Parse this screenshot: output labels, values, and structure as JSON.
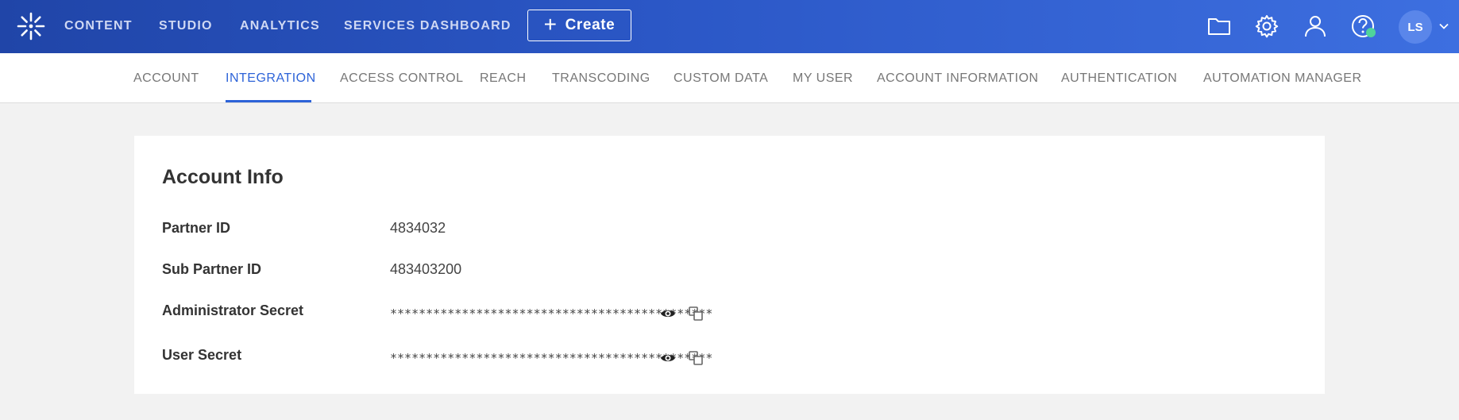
{
  "topnav": {
    "items": [
      {
        "label": "CONTENT"
      },
      {
        "label": "STUDIO"
      },
      {
        "label": "ANALYTICS"
      },
      {
        "label": "SERVICES DASHBOARD"
      }
    ],
    "create_label": "Create",
    "icons": [
      "logo-icon",
      "folder-icon",
      "gear-icon",
      "user-icon",
      "help-icon",
      "chevron-down-icon"
    ],
    "avatar_initials": "LS"
  },
  "subnav": {
    "items": [
      {
        "label": "ACCOUNT"
      },
      {
        "label": "INTEGRATION"
      },
      {
        "label": "ACCESS CONTROL"
      },
      {
        "label": "REACH"
      },
      {
        "label": "TRANSCODING"
      },
      {
        "label": "CUSTOM DATA"
      },
      {
        "label": "MY USER"
      },
      {
        "label": "ACCOUNT INFORMATION"
      },
      {
        "label": "AUTHENTICATION"
      },
      {
        "label": "AUTOMATION MANAGER"
      }
    ],
    "active": "INTEGRATION"
  },
  "account_info": {
    "title": "Account Info",
    "rows": [
      {
        "label": "Partner ID",
        "value": "4834032"
      },
      {
        "label": "Sub Partner ID",
        "value": "483403200"
      },
      {
        "label": "Administrator Secret",
        "value": "*********************************************"
      },
      {
        "label": "User Secret",
        "value": "*********************************************"
      }
    ]
  },
  "colors": {
    "header_start": "#2045a8",
    "header_end": "#3d6fe0",
    "active_tab": "#2d63d8",
    "status_dot": "#4fd49a"
  }
}
